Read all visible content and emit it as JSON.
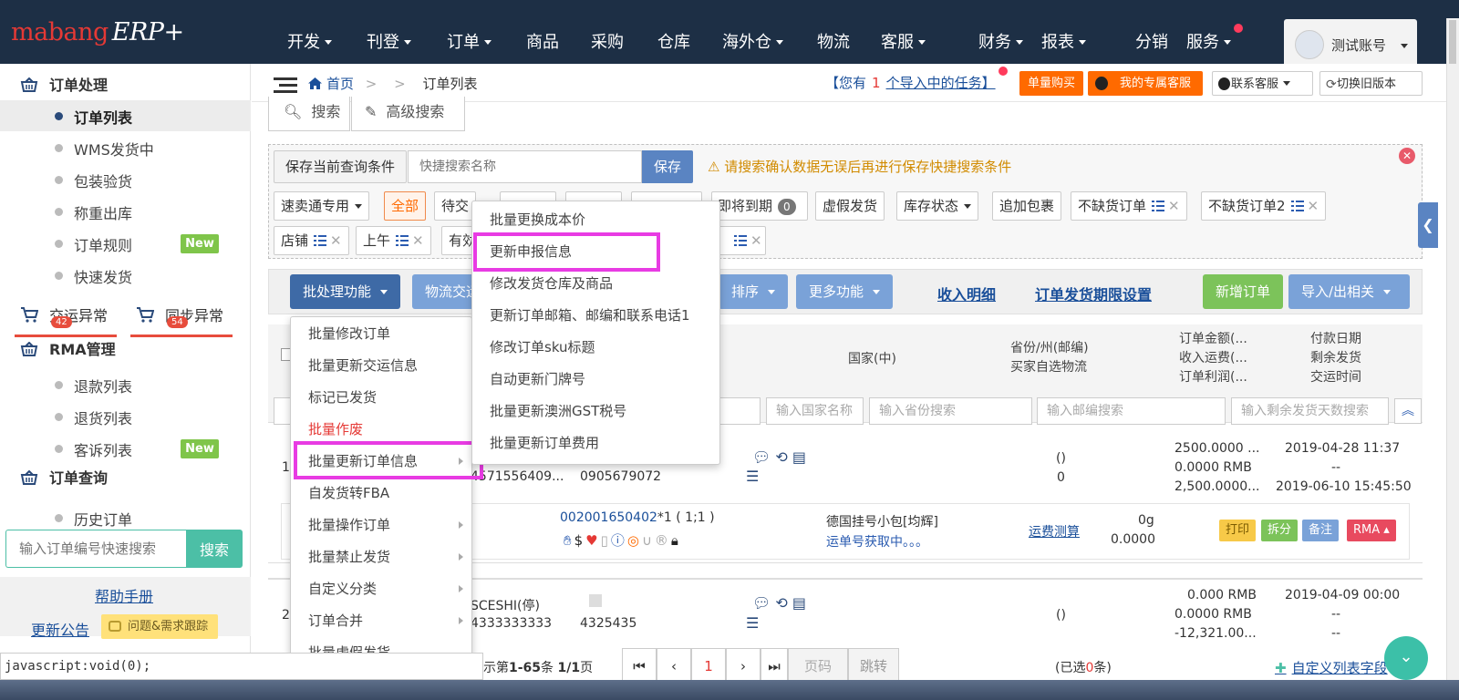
{
  "app": {
    "logo_main": "mabang",
    "logo_sub": "ERP+"
  },
  "nav": [
    {
      "label": "开发",
      "caret": true
    },
    {
      "label": "刊登",
      "caret": true
    },
    {
      "label": "订单",
      "caret": true
    },
    {
      "label": "商品",
      "caret": false
    },
    {
      "label": "采购",
      "caret": false
    },
    {
      "label": "仓库",
      "caret": false
    },
    {
      "label": "海外仓",
      "caret": true
    },
    {
      "label": "物流",
      "caret": false
    },
    {
      "label": "客服",
      "caret": true
    },
    {
      "label": "财务",
      "caret": true
    },
    {
      "label": "报表",
      "caret": true
    },
    {
      "label": "分销",
      "caret": false
    },
    {
      "label": "服务",
      "caret": true
    }
  ],
  "account": {
    "name": "测试账号"
  },
  "sidebar": {
    "order_processing": "订单处理",
    "items1": [
      {
        "label": "订单列表",
        "active": true
      },
      {
        "label": "WMS发货中"
      },
      {
        "label": "包装验货"
      },
      {
        "label": "称重出库"
      },
      {
        "label": "订单规则",
        "badge": "New"
      },
      {
        "label": "快速发货"
      }
    ],
    "exceptions": [
      {
        "label": "交运异常",
        "count": "42"
      },
      {
        "label": "同步异常",
        "count": "54"
      }
    ],
    "rma": "RMA管理",
    "items2": [
      {
        "label": "退款列表"
      },
      {
        "label": "退货列表"
      },
      {
        "label": "客诉列表",
        "badge": "New"
      }
    ],
    "order_query": "订单查询",
    "items3": [
      {
        "label": "历史订单"
      }
    ],
    "quick_search": {
      "placeholder": "输入订单编号快速搜索",
      "button": "搜索"
    },
    "help": "帮助手册",
    "announce": "更新公告",
    "issue": "问题&需求跟踪"
  },
  "breadcrumb": {
    "home": "首页",
    "sep1": ">",
    "sep2": ">",
    "current": "订单列表"
  },
  "header": {
    "tasks_pre": "【您有",
    "tasks_count": "1",
    "tasks_post": "个导入中的任务】",
    "buy_button": "单量购买",
    "service_button": "我的专属客服",
    "contact_button": "联系客服",
    "switch_button": "切换旧版本"
  },
  "search_tabs": {
    "search": "搜索",
    "advanced": "高级搜索"
  },
  "save_query": {
    "label": "保存当前查询条件",
    "placeholder": "快捷搜索名称",
    "save": "保存",
    "warning": "请搜索确认数据无误后再进行保存快捷搜索条件"
  },
  "filters_row1": [
    "速卖通专用",
    "全部",
    "待交",
    "即将到期",
    "0",
    "虚假发货",
    "库存状态",
    "追加包裹",
    "不缺货订单",
    "不缺货订单2"
  ],
  "filters_row2": [
    "店铺",
    "上午",
    "有効"
  ],
  "actions": {
    "batch": "批处理功能",
    "logistics": "物流交运",
    "sort": "排序",
    "more": "更多功能",
    "income": "收入明细",
    "deadline": "订单发货期限设置",
    "new_order": "新增订单",
    "import_export": "导入/出相关"
  },
  "table_header": {
    "country": "国家(中)",
    "province": "省份/州(邮编)",
    "logistics": "买家自选物流",
    "amount": "订单金额(...",
    "freight": "收入运费(...",
    "profit": "订单利润(...",
    "pay_date": "付款日期",
    "remaining": "剩余发货",
    "ship_time": "交运时间"
  },
  "table_filters": {
    "country": "输入国家名称",
    "province": "输入省份搜索",
    "zip": "输入邮编搜索",
    "remain_days": "输入剩余发货天数搜索"
  },
  "rows": [
    {
      "index": "1",
      "phone": "4571556409...",
      "phone2": "0905679072",
      "province": "()",
      "province2": "0",
      "amount": "2500.0000 ...",
      "freight": "0.0000 RMB",
      "profit": "2,500.0000...",
      "pay_date": "2019-04-28 11:37",
      "remaining": "--",
      "ship_time": "2019-06-10 15:45:50",
      "sku": "002001650402",
      "sku_qty": "*1 ( 1;1 )",
      "logistics": "德国挂号小包[均辉]",
      "tracking": "运单号获取中。。。",
      "calc": "运费测算",
      "weight": "0g",
      "cost": "0.0000",
      "buttons": [
        "打印",
        "拆分",
        "备注",
        "RMA"
      ]
    },
    {
      "index": "2",
      "buyer": "SCESHI(停)",
      "phone": "4333333333",
      "phone2": "4325435",
      "province": "()",
      "amount": "0.000 RMB",
      "freight": "0.0000 RMB",
      "profit": "-12,321.00...",
      "pay_date": "2019-04-09 00:00",
      "remaining": "--",
      "ship_time": "--"
    }
  ],
  "pager": {
    "info_pre": "显示第",
    "range": "1-65",
    "info_mid": "条",
    "pages": "1/1",
    "info_post": "页",
    "current": "1",
    "page_input": "页码",
    "jump": "跳转",
    "selected_pre": "(已选",
    "selected": "0",
    "selected_post": "条)",
    "custom": "自定义列表字段"
  },
  "batch_menu": [
    {
      "label": "批量修改订单"
    },
    {
      "label": "批量更新交运信息"
    },
    {
      "label": "标记已发货"
    },
    {
      "label": "批量作废",
      "danger": true
    },
    {
      "label": "批量更新订单信息",
      "sub": true
    },
    {
      "label": "自发货转FBA"
    },
    {
      "label": "批量操作订单",
      "sub": true
    },
    {
      "label": "批量禁止发货",
      "sub": true
    },
    {
      "label": "自定义分类",
      "sub": true
    },
    {
      "label": "订单合并",
      "sub": true
    },
    {
      "label": "批量虚假发货"
    }
  ],
  "submenu": [
    "批量更换成本价",
    "更新申报信息",
    "修改发货仓库及商品",
    "更新订单邮箱、邮编和联系电话1",
    "修改订单sku标题",
    "自动更新门牌号",
    "批量更新澳洲GST税号",
    "批量更新订单费用"
  ],
  "statusbar": "javascript:void(0);",
  "colors": {
    "topbar": "#1d2f45",
    "highlight": "#e83be3",
    "brand_red": "#e53935",
    "teal": "#4cbfa6",
    "btn_blue": "#5a84c2"
  }
}
